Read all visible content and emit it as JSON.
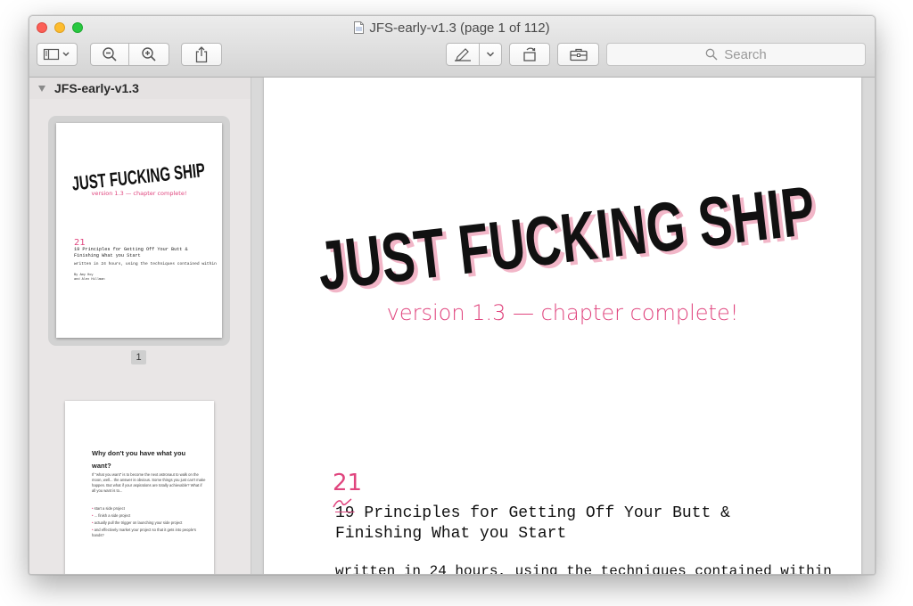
{
  "window": {
    "title": "JFS-early-v1.3 (page 1 of 112)"
  },
  "toolbar": {
    "search_placeholder": "Search"
  },
  "sidebar": {
    "title": "JFS-early-v1.3",
    "thumbnails": [
      {
        "page_label": "1",
        "title": "JUST FUCKING SHIP",
        "subtitle": "version 1.3 — chapter complete!",
        "handwritten_number": "21",
        "principles": "19 Principles for Getting Off Your Butt & Finishing What you Start",
        "written": "written in 24 hours, using the techniques contained within",
        "by_line_1": "By Amy Hoy",
        "by_line_2": "and Alex Hillman"
      },
      {
        "heading": "Why don't you have what you want?",
        "body": "If \"what you want\" is to become the next astronaut to walk on the moon, well... the answer is obvious. Some things you just can't make happen. But what if your aspirations are totally achievable? What if all you want is to...",
        "list": [
          "start a side project",
          "... finish a side project",
          "actually pull the trigger on launching your side project",
          "and effectively market your project so that it gets into people's hands?"
        ]
      }
    ]
  },
  "page": {
    "title": "JUST FUCKING SHIP",
    "subtitle": "version 1.3 — chapter complete!",
    "handwritten_number": "21",
    "old_number": "19",
    "principles_rest": " Principles for Getting Off Your Butt & Finishing What you Start",
    "written": "written in 24 hours, using the techniques contained within"
  }
}
